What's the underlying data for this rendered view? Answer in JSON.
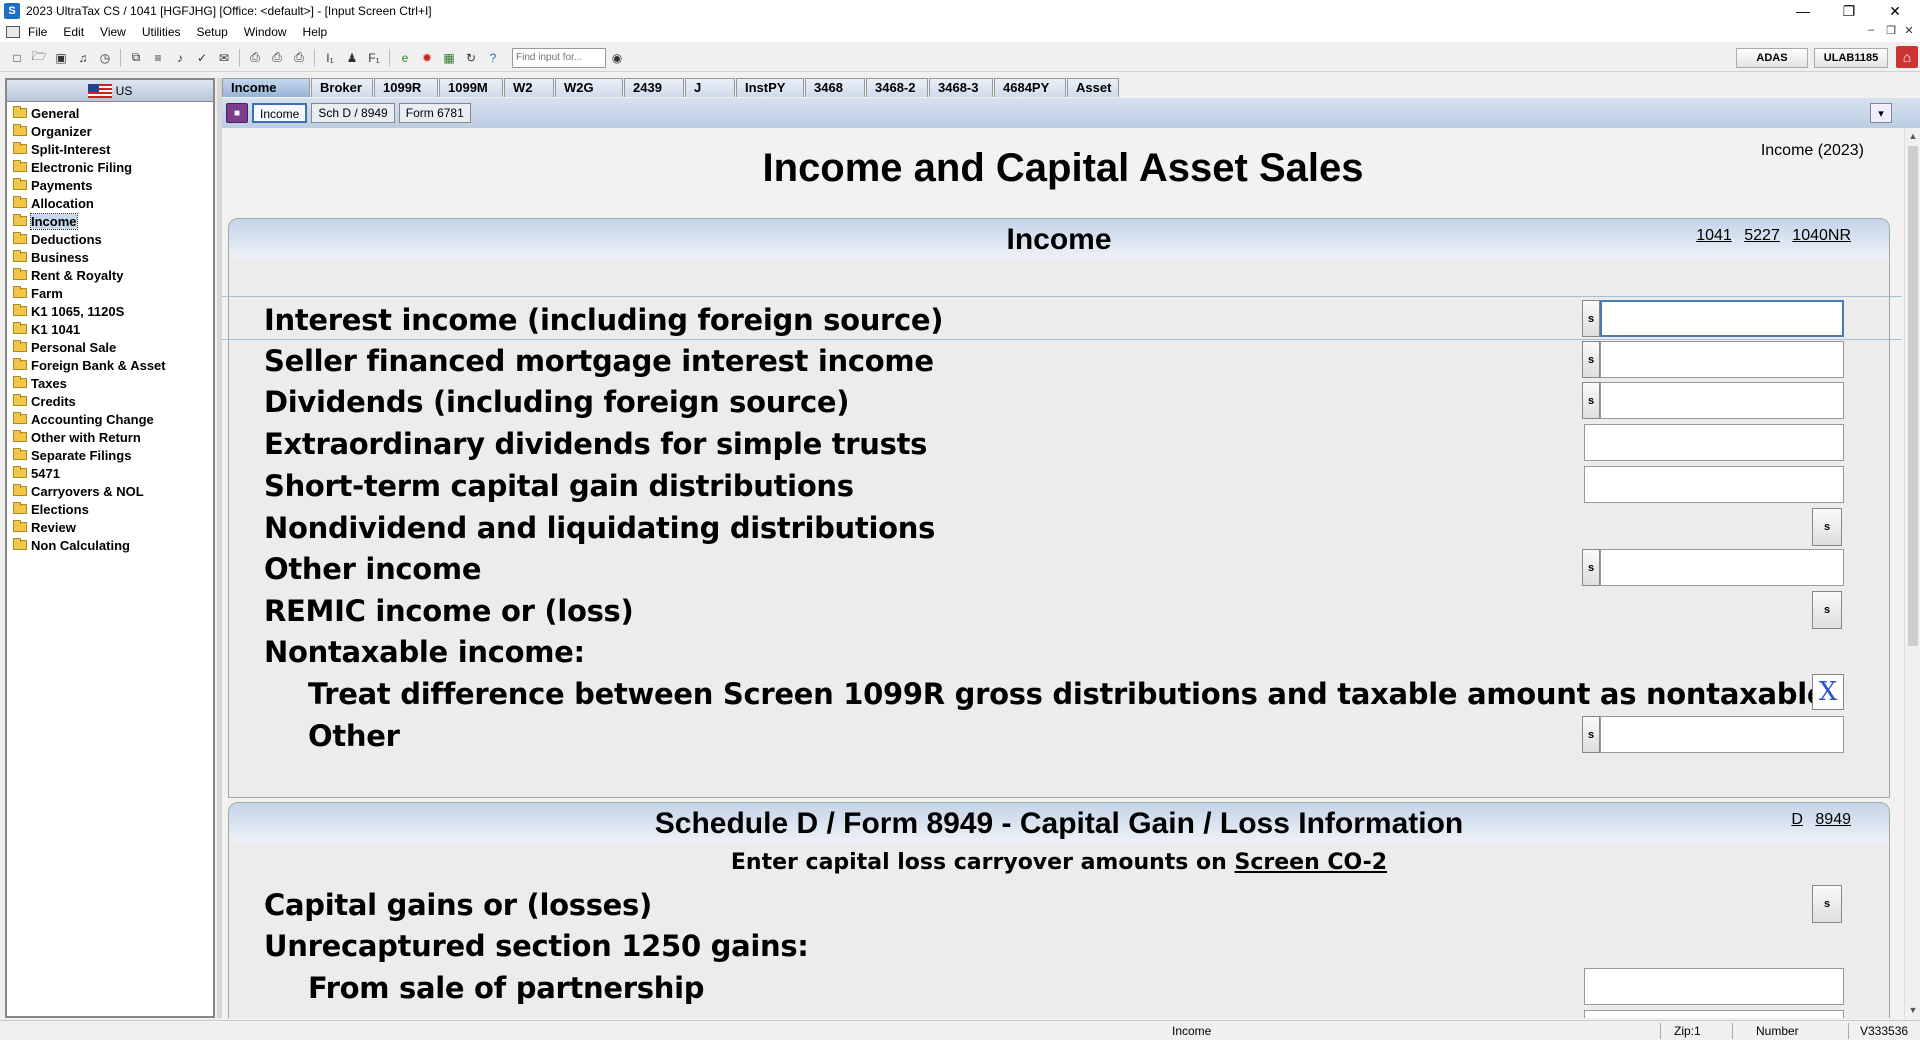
{
  "window": {
    "title": "2023 UltraTax CS  / 1041 [HGFJHG] [Office: <default>] - [Input Screen    Ctrl+I]"
  },
  "menu": [
    "File",
    "Edit",
    "View",
    "Utilities",
    "Setup",
    "Window",
    "Help"
  ],
  "toolbar": {
    "find_placeholder": "Find input for...",
    "adas_label": "ADAS",
    "user_label": "ULAB1185"
  },
  "sidebar": {
    "header": "US",
    "items": [
      "General",
      "Organizer",
      "Split-Interest",
      "Electronic Filing",
      "Payments",
      "Allocation",
      "Income",
      "Deductions",
      "Business",
      "Rent & Royalty",
      "Farm",
      "K1 1065, 1120S",
      "K1 1041",
      "Personal Sale",
      "Foreign Bank & Asset",
      "Taxes",
      "Credits",
      "Accounting Change",
      "Other with Return",
      "Separate Filings",
      "5471",
      "Carryovers & NOL",
      "Elections",
      "Review",
      "Non Calculating"
    ],
    "selected": "Income"
  },
  "tabs": [
    "Income",
    "Broker",
    "1099R",
    "1099M",
    "W2",
    "W2G",
    "2439",
    "J",
    "InstPY",
    "3468",
    "3468-2",
    "3468-3",
    "4684PY",
    "Asset"
  ],
  "subtabs": [
    "Income",
    "Sch D / 8949",
    "Form 6781"
  ],
  "form": {
    "title": "Income and Capital Asset Sales",
    "ref": "Income (2023)",
    "income_section": {
      "title": "Income",
      "links": [
        "1041",
        "5227",
        "1040NR"
      ],
      "rows": [
        "Interest income (including foreign source)",
        "Seller financed mortgage interest income",
        "Dividends (including foreign source)",
        "Extraordinary dividends for simple trusts",
        "Short-term capital gain distributions",
        "Nondividend and liquidating distributions",
        "Other income",
        "REMIC income or (loss)",
        "Nontaxable income:",
        "Treat difference between Screen 1099R gross distributions and taxable amount as nontaxable",
        "Other"
      ],
      "check_mark": "X"
    },
    "schd_section": {
      "title": "Schedule D / Form 8949 - Capital Gain / Loss Information",
      "links": [
        "D",
        "8949"
      ],
      "note_prefix": "Enter capital loss carryover amounts on ",
      "note_link": "Screen CO-2",
      "rows": [
        "Capital gains or (losses)",
        "Unrecaptured section 1250 gains:",
        "From sale of partnership"
      ]
    },
    "s_button": "s"
  },
  "status": {
    "screen": "Income",
    "zip": "Zip:1",
    "mode": "Number",
    "version": "V333536"
  }
}
